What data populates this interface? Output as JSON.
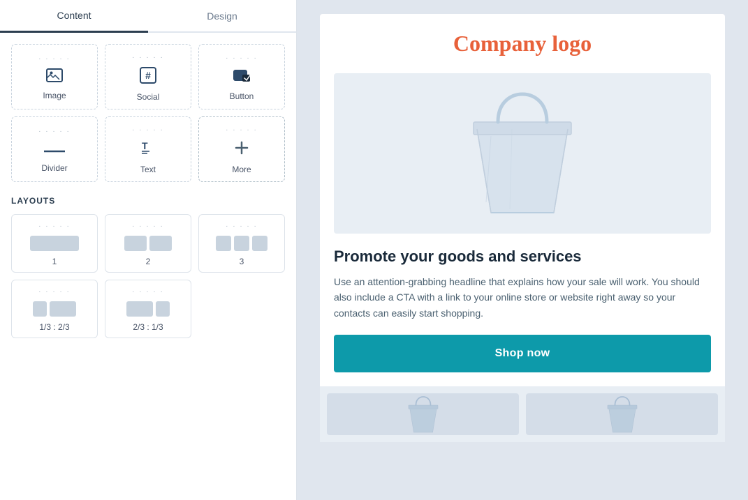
{
  "tabs": [
    {
      "id": "content",
      "label": "Content",
      "active": true
    },
    {
      "id": "design",
      "label": "Design",
      "active": false
    }
  ],
  "components": [
    {
      "id": "image",
      "label": "Image",
      "icon": "image",
      "dots": "........."
    },
    {
      "id": "social",
      "label": "Social",
      "icon": "hashtag",
      "dots": "........."
    },
    {
      "id": "button",
      "label": "Button",
      "icon": "cursor",
      "dots": "........."
    },
    {
      "id": "divider",
      "label": "Divider",
      "icon": "minus",
      "dots": "........."
    },
    {
      "id": "text",
      "label": "Text",
      "icon": "text",
      "dots": "........."
    },
    {
      "id": "more",
      "label": "More",
      "icon": "plus",
      "dots": "........."
    }
  ],
  "layouts_section": {
    "title": "LAYOUTS",
    "items": [
      {
        "id": "layout-1",
        "label": "1",
        "type": "single"
      },
      {
        "id": "layout-2",
        "label": "2",
        "type": "double"
      },
      {
        "id": "layout-3",
        "label": "3",
        "type": "triple"
      },
      {
        "id": "layout-1-3-2-3",
        "label": "1/3 : 2/3",
        "type": "one-third-two-thirds"
      },
      {
        "id": "layout-2-3-1-3",
        "label": "2/3 : 1/3",
        "type": "two-thirds-one-third"
      }
    ]
  },
  "email_preview": {
    "company_logo": "Company logo",
    "promo_headline": "Promote your goods and services",
    "promo_text": "Use an attention-grabbing headline that explains how your sale will work. You should also include a CTA with a link to your online store or website right away so your contacts can easily start shopping.",
    "shop_now_label": "Shop now"
  }
}
